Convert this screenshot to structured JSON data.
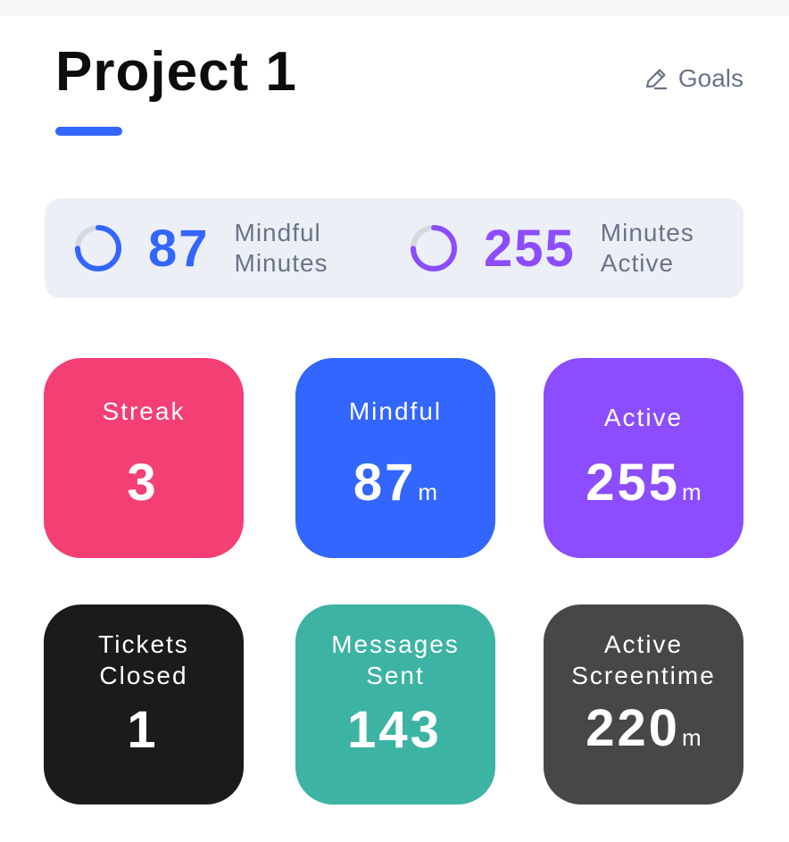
{
  "header": {
    "title": "Project 1",
    "goals_label": "Goals",
    "goals_icon": "pencil-icon",
    "accent": "#3366ff"
  },
  "summary": {
    "mindful": {
      "value": "87",
      "label": "Mindful Minutes",
      "color": "#3366ff",
      "ring_icon": "progress-ring-icon"
    },
    "active": {
      "value": "255",
      "label": "Minutes Active",
      "color": "#8b4dff",
      "ring_icon": "progress-ring-icon"
    }
  },
  "cards": [
    {
      "label": "Streak",
      "value": "3",
      "unit": "",
      "color": "#f43f74"
    },
    {
      "label": "Mindful",
      "value": "87",
      "unit": "m",
      "color": "#3366ff"
    },
    {
      "label": "Active",
      "value": "255",
      "unit": "m",
      "color": "#8b4dff"
    },
    {
      "label": "Tickets Closed",
      "value": "1",
      "unit": "",
      "color": "#1c1b1c"
    },
    {
      "label": "Messages Sent",
      "value": "143",
      "unit": "",
      "color": "#3db3a3"
    },
    {
      "label": "Active Screentime",
      "value": "220",
      "unit": "m",
      "color": "#464749"
    }
  ]
}
